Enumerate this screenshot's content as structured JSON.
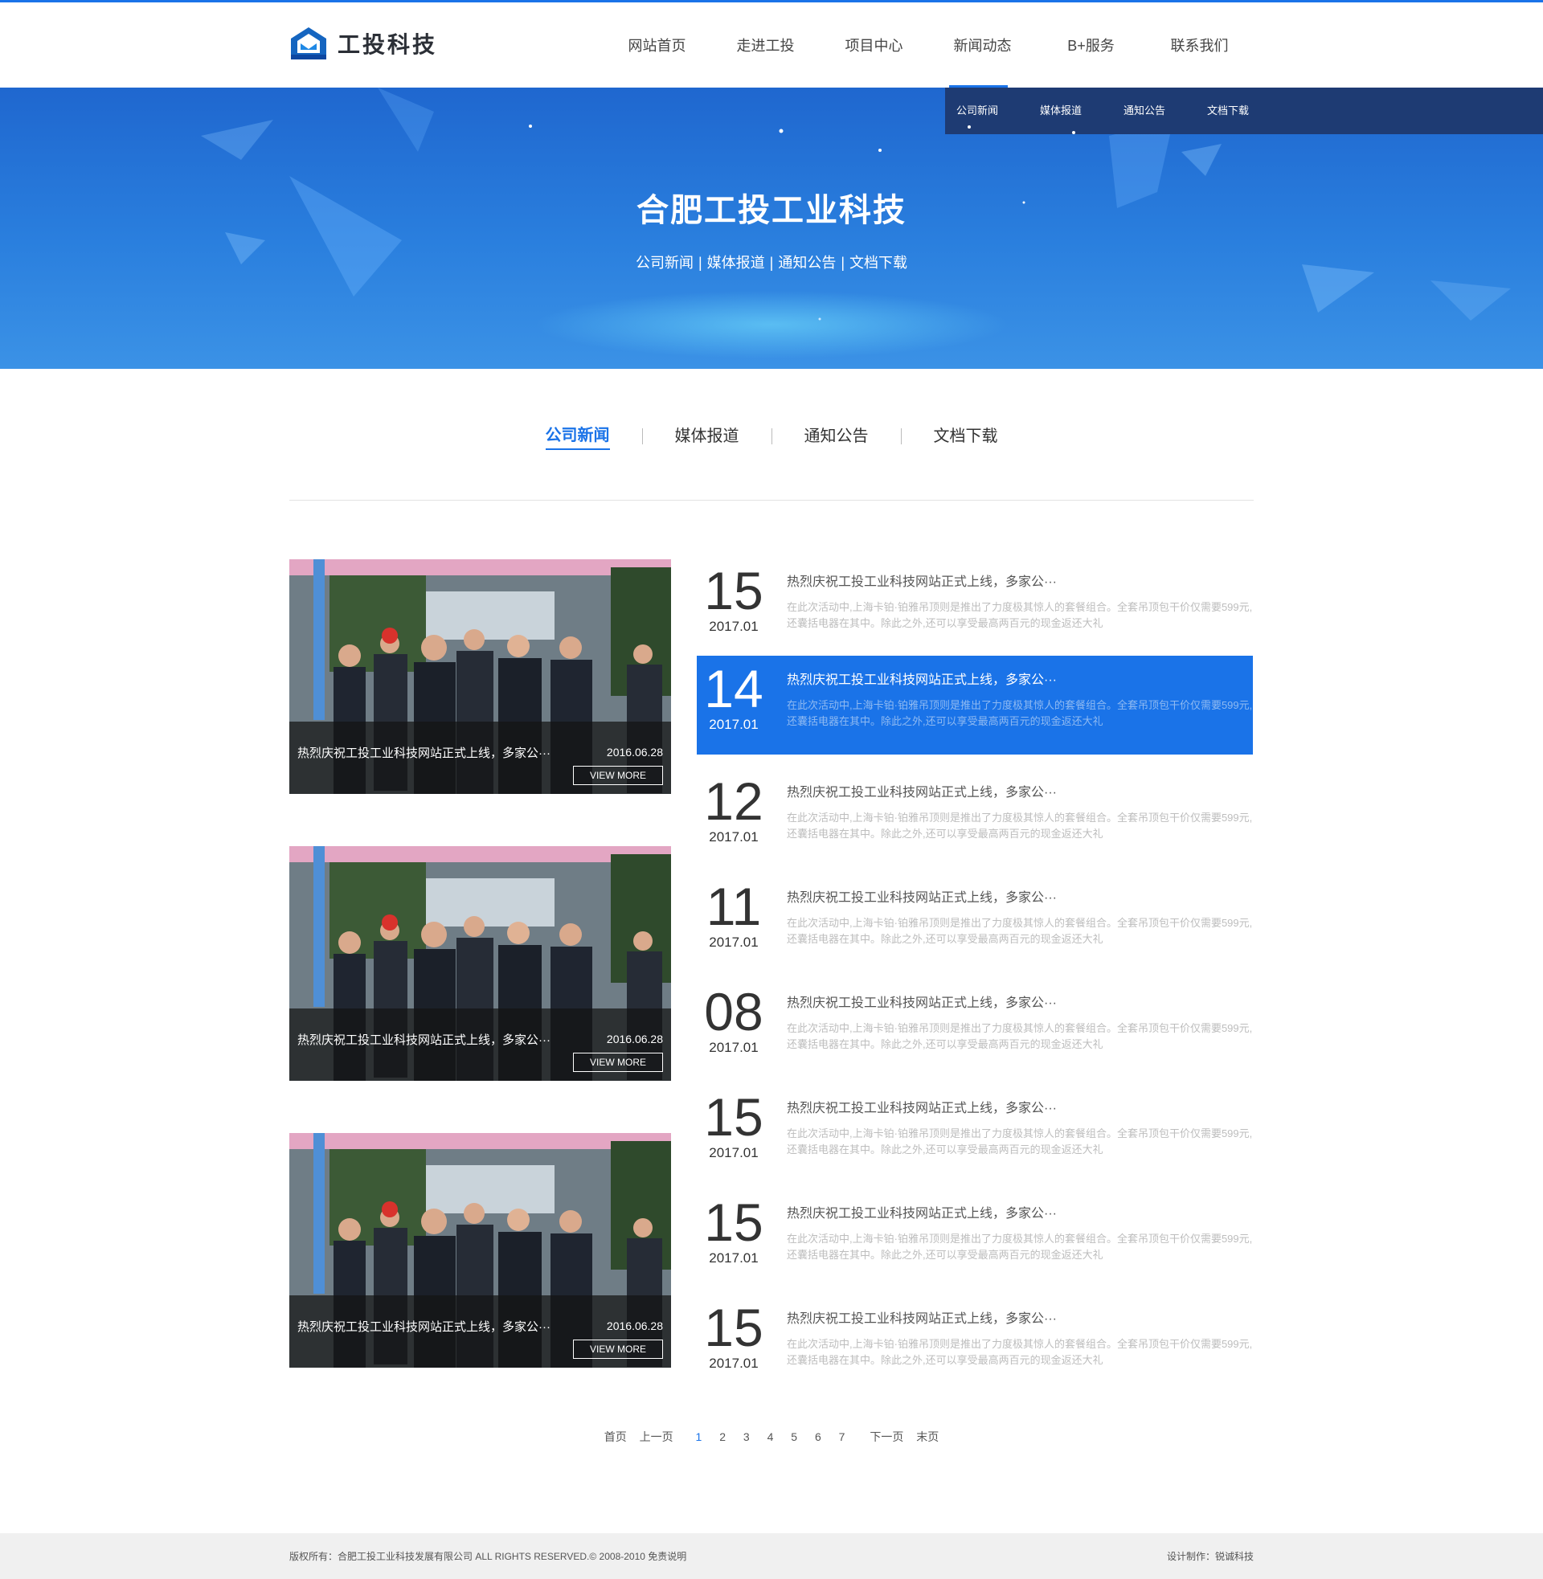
{
  "header": {
    "logo_text": "工投科技",
    "nav": [
      "网站首页",
      "走进工投",
      "项目中心",
      "新闻动态",
      "B+服务",
      "联系我们"
    ],
    "active_nav": "新闻动态"
  },
  "subnav": [
    "公司新闻",
    "媒体报道",
    "通知公告",
    "文档下载"
  ],
  "banner": {
    "title": "合肥工投工业科技",
    "links": [
      "公司新闻",
      "媒体报道",
      "通知公告",
      "文档下载"
    ]
  },
  "tabs": [
    "公司新闻",
    "媒体报道",
    "通知公告",
    "文档下载"
  ],
  "active_tab": "公司新闻",
  "featured": [
    {
      "title": "热烈庆祝工投工业科技网站正式上线，多家公···",
      "date": "2016.06.28",
      "more": "VIEW MORE"
    },
    {
      "title": "热烈庆祝工投工业科技网站正式上线，多家公···",
      "date": "2016.06.28",
      "more": "VIEW MORE"
    },
    {
      "title": "热烈庆祝工投工业科技网站正式上线，多家公···",
      "date": "2016.06.28",
      "more": "VIEW MORE"
    }
  ],
  "news": [
    {
      "day": "15",
      "ym": "2017.01",
      "title": "热烈庆祝工投工业科技网站正式上线，多家公···",
      "desc": "在此次活动中,上海卡铂·铂雅吊顶则是推出了力度极其惊人的套餐组合。全套吊顶包干价仅需要599元,还囊括电器在其中。除此之外,还可以享受最高两百元的现金返还大礼"
    },
    {
      "day": "14",
      "ym": "2017.01",
      "title": "热烈庆祝工投工业科技网站正式上线，多家公···",
      "desc": "在此次活动中,上海卡铂·铂雅吊顶则是推出了力度极其惊人的套餐组合。全套吊顶包干价仅需要599元,还囊括电器在其中。除此之外,还可以享受最高两百元的现金返还大礼"
    },
    {
      "day": "12",
      "ym": "2017.01",
      "title": "热烈庆祝工投工业科技网站正式上线，多家公···",
      "desc": "在此次活动中,上海卡铂·铂雅吊顶则是推出了力度极其惊人的套餐组合。全套吊顶包干价仅需要599元,还囊括电器在其中。除此之外,还可以享受最高两百元的现金返还大礼"
    },
    {
      "day": "11",
      "ym": "2017.01",
      "title": "热烈庆祝工投工业科技网站正式上线，多家公···",
      "desc": "在此次活动中,上海卡铂·铂雅吊顶则是推出了力度极其惊人的套餐组合。全套吊顶包干价仅需要599元,还囊括电器在其中。除此之外,还可以享受最高两百元的现金返还大礼"
    },
    {
      "day": "08",
      "ym": "2017.01",
      "title": "热烈庆祝工投工业科技网站正式上线，多家公···",
      "desc": "在此次活动中,上海卡铂·铂雅吊顶则是推出了力度极其惊人的套餐组合。全套吊顶包干价仅需要599元,还囊括电器在其中。除此之外,还可以享受最高两百元的现金返还大礼"
    },
    {
      "day": "15",
      "ym": "2017.01",
      "title": "热烈庆祝工投工业科技网站正式上线，多家公···",
      "desc": "在此次活动中,上海卡铂·铂雅吊顶则是推出了力度极其惊人的套餐组合。全套吊顶包干价仅需要599元,还囊括电器在其中。除此之外,还可以享受最高两百元的现金返还大礼"
    },
    {
      "day": "15",
      "ym": "2017.01",
      "title": "热烈庆祝工投工业科技网站正式上线，多家公···",
      "desc": "在此次活动中,上海卡铂·铂雅吊顶则是推出了力度极其惊人的套餐组合。全套吊顶包干价仅需要599元,还囊括电器在其中。除此之外,还可以享受最高两百元的现金返还大礼"
    },
    {
      "day": "15",
      "ym": "2017.01",
      "title": "热烈庆祝工投工业科技网站正式上线，多家公···",
      "desc": "在此次活动中,上海卡铂·铂雅吊顶则是推出了力度极其惊人的套餐组合。全套吊顶包干价仅需要599元,还囊括电器在其中。除此之外,还可以享受最高两百元的现金返还大礼"
    }
  ],
  "active_news_index": 1,
  "pager": {
    "first": "首页",
    "prev": "上一页",
    "pages": [
      "1",
      "2",
      "3",
      "4",
      "5",
      "6",
      "7"
    ],
    "current": "1",
    "next": "下一页",
    "last": "末页"
  },
  "footer": {
    "copyright": "版权所有：合肥工投工业科技发展有限公司  ALL RIGHTS RESERVED.© 2008-2010  免责说明",
    "design": "设计制作：锐诚科技"
  },
  "colors": {
    "accent": "#1a73e8",
    "subnav_bg": "#1e3b73",
    "banner": "#2a7fde",
    "footer_bg": "#f0f0f0"
  }
}
